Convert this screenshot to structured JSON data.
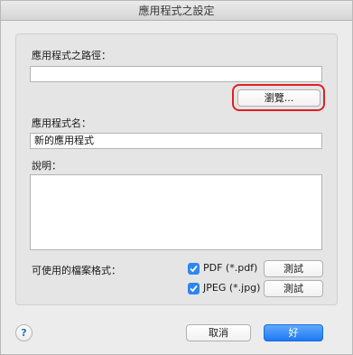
{
  "window": {
    "title": "應用程式之設定"
  },
  "path": {
    "label": "應用程式之路徑：",
    "value": "",
    "browse_label": "瀏覽..."
  },
  "app_name": {
    "label": "應用程式名：",
    "value": "新的應用程式"
  },
  "description": {
    "label": "說明：",
    "value": ""
  },
  "formats": {
    "label": "可使用的檔案格式：",
    "items": [
      {
        "label": "PDF (*.pdf)",
        "checked": true,
        "test_label": "測試"
      },
      {
        "label": "JPEG (*.jpg)",
        "checked": true,
        "test_label": "測試"
      }
    ]
  },
  "footer": {
    "help_label": "?",
    "cancel_label": "取消",
    "ok_label": "好"
  },
  "colors": {
    "accent": "#2e86f5",
    "highlight": "#e01f2a"
  }
}
